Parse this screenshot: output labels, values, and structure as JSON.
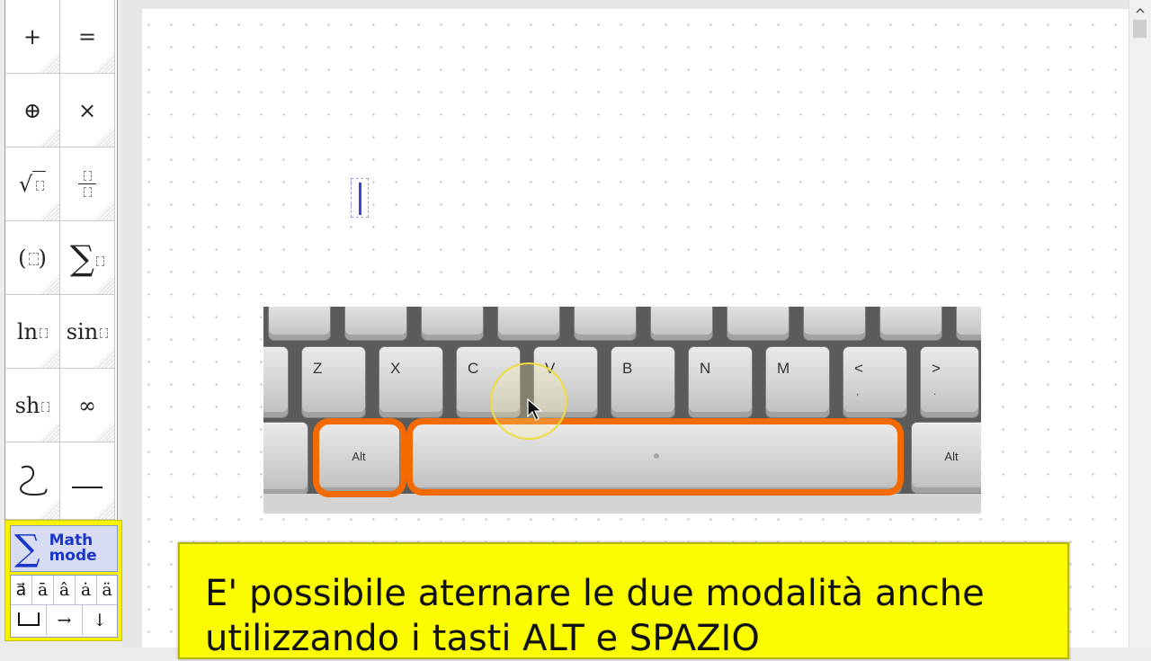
{
  "palette": {
    "buttons": [
      {
        "symbol": "+",
        "icon": "plus-icon"
      },
      {
        "symbol": "=",
        "icon": "equals-icon"
      },
      {
        "symbol": "⊕",
        "icon": "circled-plus-icon"
      },
      {
        "symbol": "×",
        "icon": "times-icon"
      },
      {
        "symbol": "√",
        "icon": "square-root-icon"
      },
      {
        "symbol": "",
        "icon": "fraction-icon"
      },
      {
        "symbol": "( )",
        "icon": "parentheses-icon"
      },
      {
        "symbol": "∑",
        "icon": "summation-icon"
      },
      {
        "symbol": "ln",
        "icon": "natural-log-icon"
      },
      {
        "symbol": "sin",
        "icon": "sine-icon"
      },
      {
        "symbol": "sh",
        "icon": "hyperbolic-sine-icon"
      },
      {
        "symbol": "∞",
        "icon": "infinity-icon"
      },
      {
        "symbol": "",
        "icon": "curve-icon"
      },
      {
        "symbol": "—",
        "icon": "horizontal-line-icon"
      }
    ]
  },
  "math_panel": {
    "sigma": "∑",
    "label_line1": "Math",
    "label_line2": "mode",
    "accents": [
      "a⃗",
      "ā",
      "â",
      "ȧ",
      "ä"
    ],
    "arrows": [
      "→",
      "↓"
    ]
  },
  "keyboard": {
    "keys": {
      "z": "Z",
      "x": "X",
      "c": "C",
      "v": "V",
      "b": "B",
      "n": "N",
      "m": "M",
      "lt": "<",
      "lt_sub": ",",
      "gt": ">",
      "gt_sub": ".",
      "alt_left": "Alt",
      "alt_right": "Alt"
    },
    "highlight_color": "#f26a00"
  },
  "caption": {
    "line1": "E' possibile aternare le due modalità anche",
    "line2": "utilizzando i tasti ALT e SPAZIO"
  },
  "colors": {
    "caption_bg": "#fcfc00",
    "math_panel_bg": "#f6f200",
    "accent_blue": "#1a36c9",
    "caret": "#3f44d8"
  }
}
